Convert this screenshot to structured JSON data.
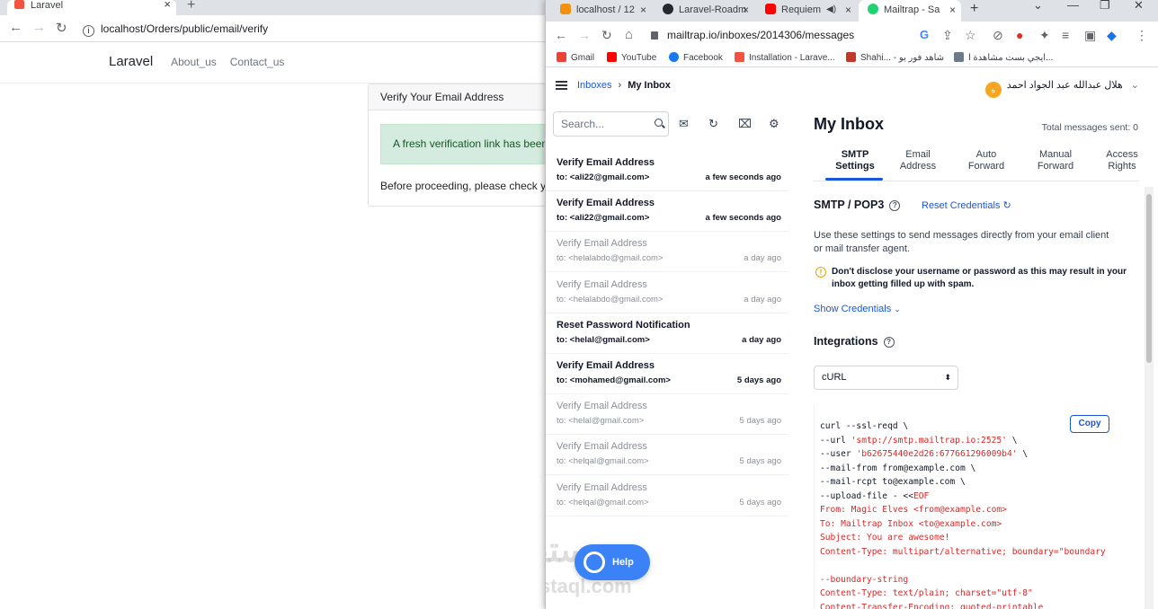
{
  "back_window": {
    "tab_title": "Laravel",
    "tab_close": "×",
    "new_tab": "+",
    "nav": {
      "back": "←",
      "forward": "→",
      "reload": "↻"
    },
    "url": "localhost/Orders/public/email/verify",
    "navbar": {
      "brand": "Laravel",
      "links": [
        "About_us",
        "Contact_us"
      ]
    },
    "card": {
      "header": "Verify Your Email Address",
      "alert": "A fresh verification link has been",
      "body": "Before proceeding, please check yo"
    }
  },
  "front_window": {
    "tabs": [
      {
        "title": "localhost / 12",
        "color": "#f29111"
      },
      {
        "title": "Laravel-Roadm",
        "color": "#24292f"
      },
      {
        "title": "Requiem",
        "color": "#ff0000"
      },
      {
        "title": "Mailtrap - Sa",
        "color": "#22d172"
      }
    ],
    "tab_close": "×",
    "new_tab": "+",
    "window_controls": {
      "chevron": "⌄",
      "minimize": "—",
      "restore": "❐",
      "close": "✕"
    },
    "nav": {
      "back": "←",
      "forward": "→",
      "reload": "↻",
      "home": "⌂"
    },
    "url": "mailtrap.io/inboxes/2014306/messages",
    "toolbar_icons": {
      "google": "G",
      "share": "⇪",
      "star": "☆",
      "block": "⊘",
      "extension": "●",
      "puzzle": "✦",
      "playlist": "≡",
      "sidebar": "▣",
      "profile": "◆",
      "menu": "⋮"
    },
    "bookmarks": [
      {
        "label": "Gmail",
        "color": "#ea4335"
      },
      {
        "label": "YouTube",
        "color": "#ff0000"
      },
      {
        "label": "Facebook",
        "color": "#1877f2"
      },
      {
        "label": "Installation - Larave...",
        "color": "#f05340"
      },
      {
        "label": "Shahi... - شاهد فور يو",
        "color": "#c0392b"
      },
      {
        "label": "ايجي بست مشاهدة ا...",
        "color": "#6c7a89"
      }
    ],
    "app": {
      "breadcrumb": {
        "inboxes": "Inboxes",
        "sep": "›",
        "current": "My Inbox"
      },
      "user": {
        "initial": "ه",
        "name": "هلال عبدالله عبد الجواد احمد",
        "caret": "⌄"
      },
      "search_placeholder": "Search...",
      "list_icons": {
        "mark_read": "✉",
        "refresh": "↻",
        "clear": "⌧",
        "settings": "⚙"
      },
      "messages": [
        {
          "subject": "Verify Email Address",
          "to": "to: <ali22@gmail.com>",
          "time": "a few seconds ago",
          "unread": true
        },
        {
          "subject": "Verify Email Address",
          "to": "to: <ali22@gmail.com>",
          "time": "a few seconds ago",
          "unread": true
        },
        {
          "subject": "Verify Email Address",
          "to": "to: <helalabdo@gmail.com>",
          "time": "a day ago",
          "unread": false
        },
        {
          "subject": "Verify Email Address",
          "to": "to: <helalabdo@gmail.com>",
          "time": "a day ago",
          "unread": false
        },
        {
          "subject": "Reset Password Notification",
          "to": "to: <helal@gmail.com>",
          "time": "a day ago",
          "unread": true
        },
        {
          "subject": "Verify Email Address",
          "to": "to: <mohamed@gmail.com>",
          "time": "5 days ago",
          "unread": true
        },
        {
          "subject": "Verify Email Address",
          "to": "to: <helal@gmail.com>",
          "time": "5 days ago",
          "unread": false
        },
        {
          "subject": "Verify Email Address",
          "to": "to: <helqal@gmail.com>",
          "time": "5 days ago",
          "unread": false
        },
        {
          "subject": "Verify Email Address",
          "to": "to: <helqal@gmail.com>",
          "time": "5 days ago",
          "unread": false
        }
      ],
      "help_label": "Help",
      "watermark": {
        "arabic": "مستقل",
        "latin": "mostaql.com"
      },
      "inbox_title": "My Inbox",
      "total_sent": "Total messages sent: 0",
      "settings_tabs": [
        {
          "line1": "SMTP",
          "line2": "Settings",
          "active": true
        },
        {
          "line1": "Email",
          "line2": "Address",
          "active": false
        },
        {
          "line1": "Auto",
          "line2": "Forward",
          "active": false
        },
        {
          "line1": "Manual",
          "line2": "Forward",
          "active": false
        },
        {
          "line1": "Access",
          "line2": "Rights",
          "active": false
        }
      ],
      "smtp_heading": "SMTP / POP3",
      "help_mark": "?",
      "reset_credentials": "Reset Credentials",
      "reset_icon": "↻",
      "description": "Use these settings to send messages directly from your email client or mail transfer agent.",
      "warning_icon": "!",
      "warning": "Don't disclose your username or password as this may result in your inbox getting filled up with spam.",
      "show_credentials": "Show Credentials",
      "show_caret": "⌄",
      "integrations_heading": "Integrations",
      "integration_selected": "cURL",
      "select_arrow": "⬍",
      "copy_label": "Copy",
      "code_lines": [
        {
          "text": "curl --ssl-reqd \\",
          "red": false
        },
        {
          "pre": "--url ",
          "str": "'smtp://smtp.mailtrap.io:2525'",
          "post": " \\",
          "red": false
        },
        {
          "pre": "--user ",
          "str": "'b62675440e2d26:677661296009b4'",
          "post": " \\",
          "red": false
        },
        {
          "text": "--mail-from from@example.com \\",
          "red": false
        },
        {
          "text": "--mail-rcpt to@example.com \\",
          "red": false
        },
        {
          "pre": "--upload-file - <<",
          "str": "EOF",
          "post": "",
          "red": false
        },
        {
          "text": "From: Magic Elves <from@example.com>",
          "red": true
        },
        {
          "text": "To: Mailtrap Inbox <to@example.com>",
          "red": true
        },
        {
          "text": "Subject: You are awesome!",
          "red": true
        },
        {
          "text": "Content-Type: multipart/alternative; boundary=\"boundary",
          "red": true
        },
        {
          "text": "",
          "red": true
        },
        {
          "text": "--boundary-string",
          "red": true
        },
        {
          "text": "Content-Type: text/plain; charset=\"utf-8\"",
          "red": true
        },
        {
          "text": "Content-Transfer-Encoding: quoted-printable",
          "red": true
        }
      ]
    }
  }
}
